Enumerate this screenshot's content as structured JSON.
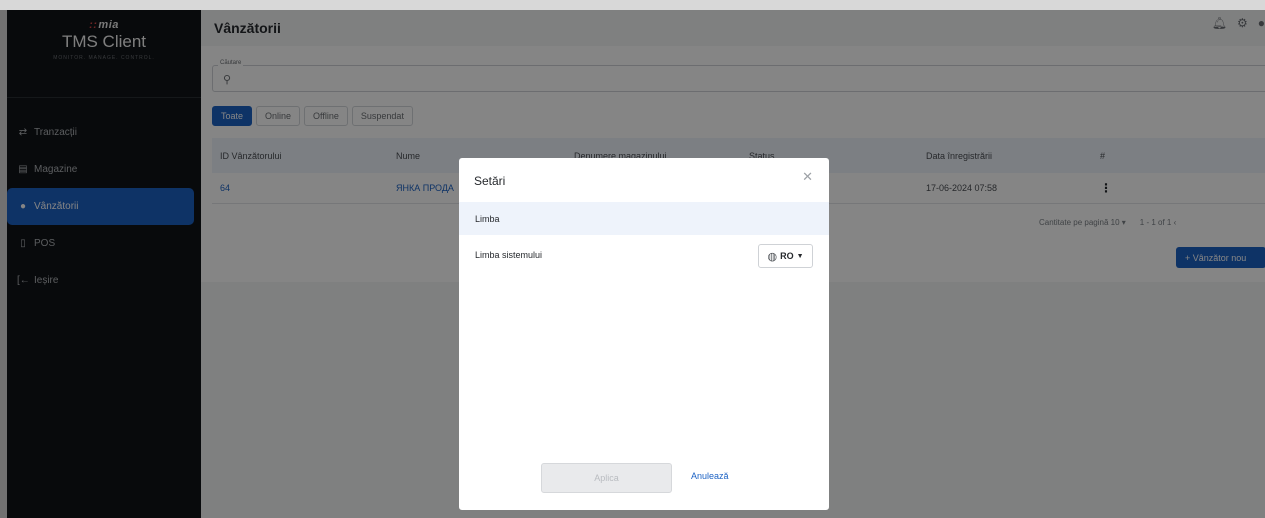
{
  "brand": {
    "logo_mark": "::",
    "logo_text": "mia",
    "title": "TMS Client",
    "subtitle": "MONITOR. MANAGE. CONTROL."
  },
  "sidebar": {
    "items": [
      {
        "label": "Tranzacții",
        "icon": "swap-arrows-icon"
      },
      {
        "label": "Magazine",
        "icon": "store-icon"
      },
      {
        "label": "Vânzătorii",
        "icon": "person-icon"
      },
      {
        "label": "POS",
        "icon": "pos-terminal-icon"
      },
      {
        "label": "Ieșire",
        "icon": "logout-icon"
      }
    ]
  },
  "header": {
    "title": "Vânzătorii"
  },
  "search": {
    "legend": "Căutare",
    "value": "",
    "placeholder": ""
  },
  "filters": [
    "Toate",
    "Online",
    "Offline",
    "Suspendat"
  ],
  "table": {
    "headers": [
      "ID Vânzătorului",
      "Nume",
      "Denumere magazinului",
      "Status",
      "Data înregistrării",
      "#"
    ],
    "rows": [
      {
        "id": "64",
        "name": "ЯНКА ПРОДА",
        "store": "",
        "status": "",
        "date": "17-06-2024 07:58"
      }
    ]
  },
  "pager": {
    "per_page_label": "Cantitate pe pagină",
    "per_page": "10",
    "range": "1 - 1 of 1"
  },
  "actions": {
    "add_seller": "+ Vânzător nou"
  },
  "modal": {
    "title": "Setări",
    "section": "Limba",
    "field_label": "Limba sistemului",
    "language": "RO",
    "apply": "Aplica",
    "cancel": "Anulează"
  },
  "colors": {
    "accent": "#1c62c4",
    "sidebar_bg": "#111417"
  }
}
